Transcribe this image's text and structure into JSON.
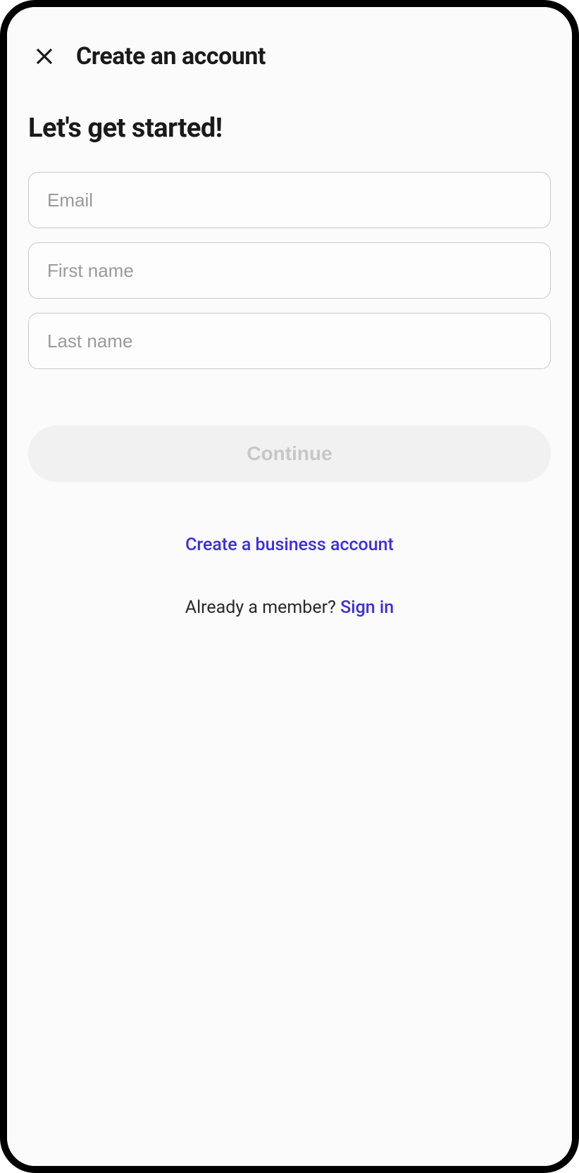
{
  "header": {
    "title": "Create an account"
  },
  "main": {
    "heading": "Let's get started!",
    "form": {
      "email": {
        "placeholder": "Email",
        "value": ""
      },
      "firstName": {
        "placeholder": "First name",
        "value": ""
      },
      "lastName": {
        "placeholder": "Last name",
        "value": ""
      },
      "continueLabel": "Continue"
    },
    "businessLink": "Create a business account",
    "memberPrompt": "Already a member? ",
    "signInLabel": "Sign in"
  }
}
